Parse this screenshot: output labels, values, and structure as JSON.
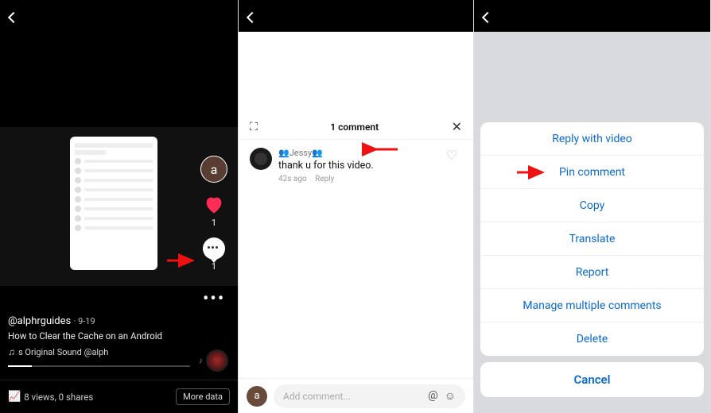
{
  "panel1": {
    "rail": {
      "avatar_letter": "a",
      "like_count": "1",
      "comment_count": "1"
    },
    "meta": {
      "username": "@alphrguides",
      "date": "9-19",
      "caption": "How to Clear the Cache on an Android",
      "sound": "s Original Sound   @alph"
    },
    "footer": {
      "stats": "8 views, 0 shares",
      "more_label": "More data"
    }
  },
  "panel2": {
    "sheet_title": "1 comment",
    "comment": {
      "name": "👥Jessy👥",
      "text": "thank   u for this video.",
      "time": "42s ago",
      "reply_label": "Reply"
    },
    "input": {
      "avatar_letter": "a",
      "placeholder": "Add comment..."
    }
  },
  "panel3": {
    "items": [
      "Reply with video",
      "Pin comment",
      "Copy",
      "Translate",
      "Report",
      "Manage multiple comments",
      "Delete"
    ],
    "cancel": "Cancel"
  }
}
